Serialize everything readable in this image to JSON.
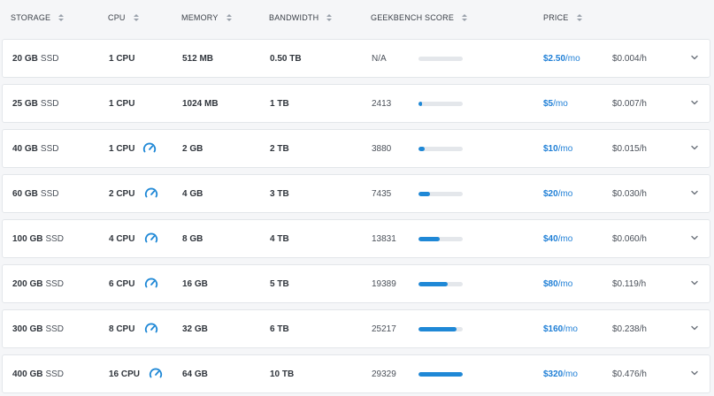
{
  "header": {
    "storage": "STORAGE",
    "cpu": "CPU",
    "memory": "MEMORY",
    "bandwidth": "BANDWIDTH",
    "geekbench": "GEEKBENCH SCORE",
    "price": "PRICE"
  },
  "colors": {
    "accent": "#1f7fd6",
    "bar": "#1f88d6",
    "track": "#e4e7eb"
  },
  "max_score": 29329,
  "rows": [
    {
      "storage_num": "20 GB",
      "storage_type": "SSD",
      "cpu": "1 CPU",
      "gauge": false,
      "memory": "512 MB",
      "bandwidth": "0.50 TB",
      "score": "N/A",
      "score_value": 0,
      "price": "$2.50",
      "price_unit": "/mo",
      "hourly": "$0.004/h"
    },
    {
      "storage_num": "25 GB",
      "storage_type": "SSD",
      "cpu": "1 CPU",
      "gauge": false,
      "memory": "1024 MB",
      "bandwidth": "1 TB",
      "score": "2413",
      "score_value": 2413,
      "price": "$5",
      "price_unit": "/mo",
      "hourly": "$0.007/h"
    },
    {
      "storage_num": "40 GB",
      "storage_type": "SSD",
      "cpu": "1 CPU",
      "gauge": true,
      "memory": "2 GB",
      "bandwidth": "2 TB",
      "score": "3880",
      "score_value": 3880,
      "price": "$10",
      "price_unit": "/mo",
      "hourly": "$0.015/h"
    },
    {
      "storage_num": "60 GB",
      "storage_type": "SSD",
      "cpu": "2 CPU",
      "gauge": true,
      "memory": "4 GB",
      "bandwidth": "3 TB",
      "score": "7435",
      "score_value": 7435,
      "price": "$20",
      "price_unit": "/mo",
      "hourly": "$0.030/h"
    },
    {
      "storage_num": "100 GB",
      "storage_type": "SSD",
      "cpu": "4 CPU",
      "gauge": true,
      "memory": "8 GB",
      "bandwidth": "4 TB",
      "score": "13831",
      "score_value": 13831,
      "price": "$40",
      "price_unit": "/mo",
      "hourly": "$0.060/h"
    },
    {
      "storage_num": "200 GB",
      "storage_type": "SSD",
      "cpu": "6 CPU",
      "gauge": true,
      "memory": "16 GB",
      "bandwidth": "5 TB",
      "score": "19389",
      "score_value": 19389,
      "price": "$80",
      "price_unit": "/mo",
      "hourly": "$0.119/h"
    },
    {
      "storage_num": "300 GB",
      "storage_type": "SSD",
      "cpu": "8 CPU",
      "gauge": true,
      "memory": "32 GB",
      "bandwidth": "6 TB",
      "score": "25217",
      "score_value": 25217,
      "price": "$160",
      "price_unit": "/mo",
      "hourly": "$0.238/h"
    },
    {
      "storage_num": "400 GB",
      "storage_type": "SSD",
      "cpu": "16 CPU",
      "gauge": true,
      "memory": "64 GB",
      "bandwidth": "10 TB",
      "score": "29329",
      "score_value": 29329,
      "price": "$320",
      "price_unit": "/mo",
      "hourly": "$0.476/h"
    }
  ]
}
